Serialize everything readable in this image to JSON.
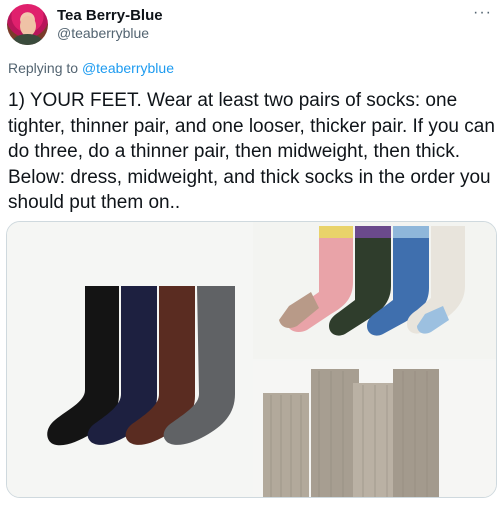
{
  "author": {
    "display_name": "Tea Berry-Blue",
    "handle": "@teaberryblue"
  },
  "reply": {
    "prefix": "Replying to",
    "mention": "@teaberryblue"
  },
  "tweet": {
    "text": "1) YOUR FEET. Wear at least two pairs of socks: one tighter, thinner pair, and one looser, thicker pair. If you can do three, do a thinner pair, then midweight, then thick. Below: dress, midweight, and thick socks in the order you should put them on.."
  },
  "more_glyph": "···",
  "media": {
    "images": [
      {
        "icon": "dress-socks-image",
        "sock_colors": [
          "#151515",
          "#1e2140",
          "#5a2d22",
          "#5f6164"
        ]
      },
      {
        "icon": "midweight-socks-image",
        "sock_colors": [
          "#e9a3a8",
          "#2f3d2c",
          "#3f6fae",
          "#e8e4dc"
        ]
      },
      {
        "icon": "thick-socks-image",
        "sock_colors": [
          "#b2a99b",
          "#a79e91",
          "#bab1a4",
          "#a39a8d"
        ]
      }
    ]
  }
}
